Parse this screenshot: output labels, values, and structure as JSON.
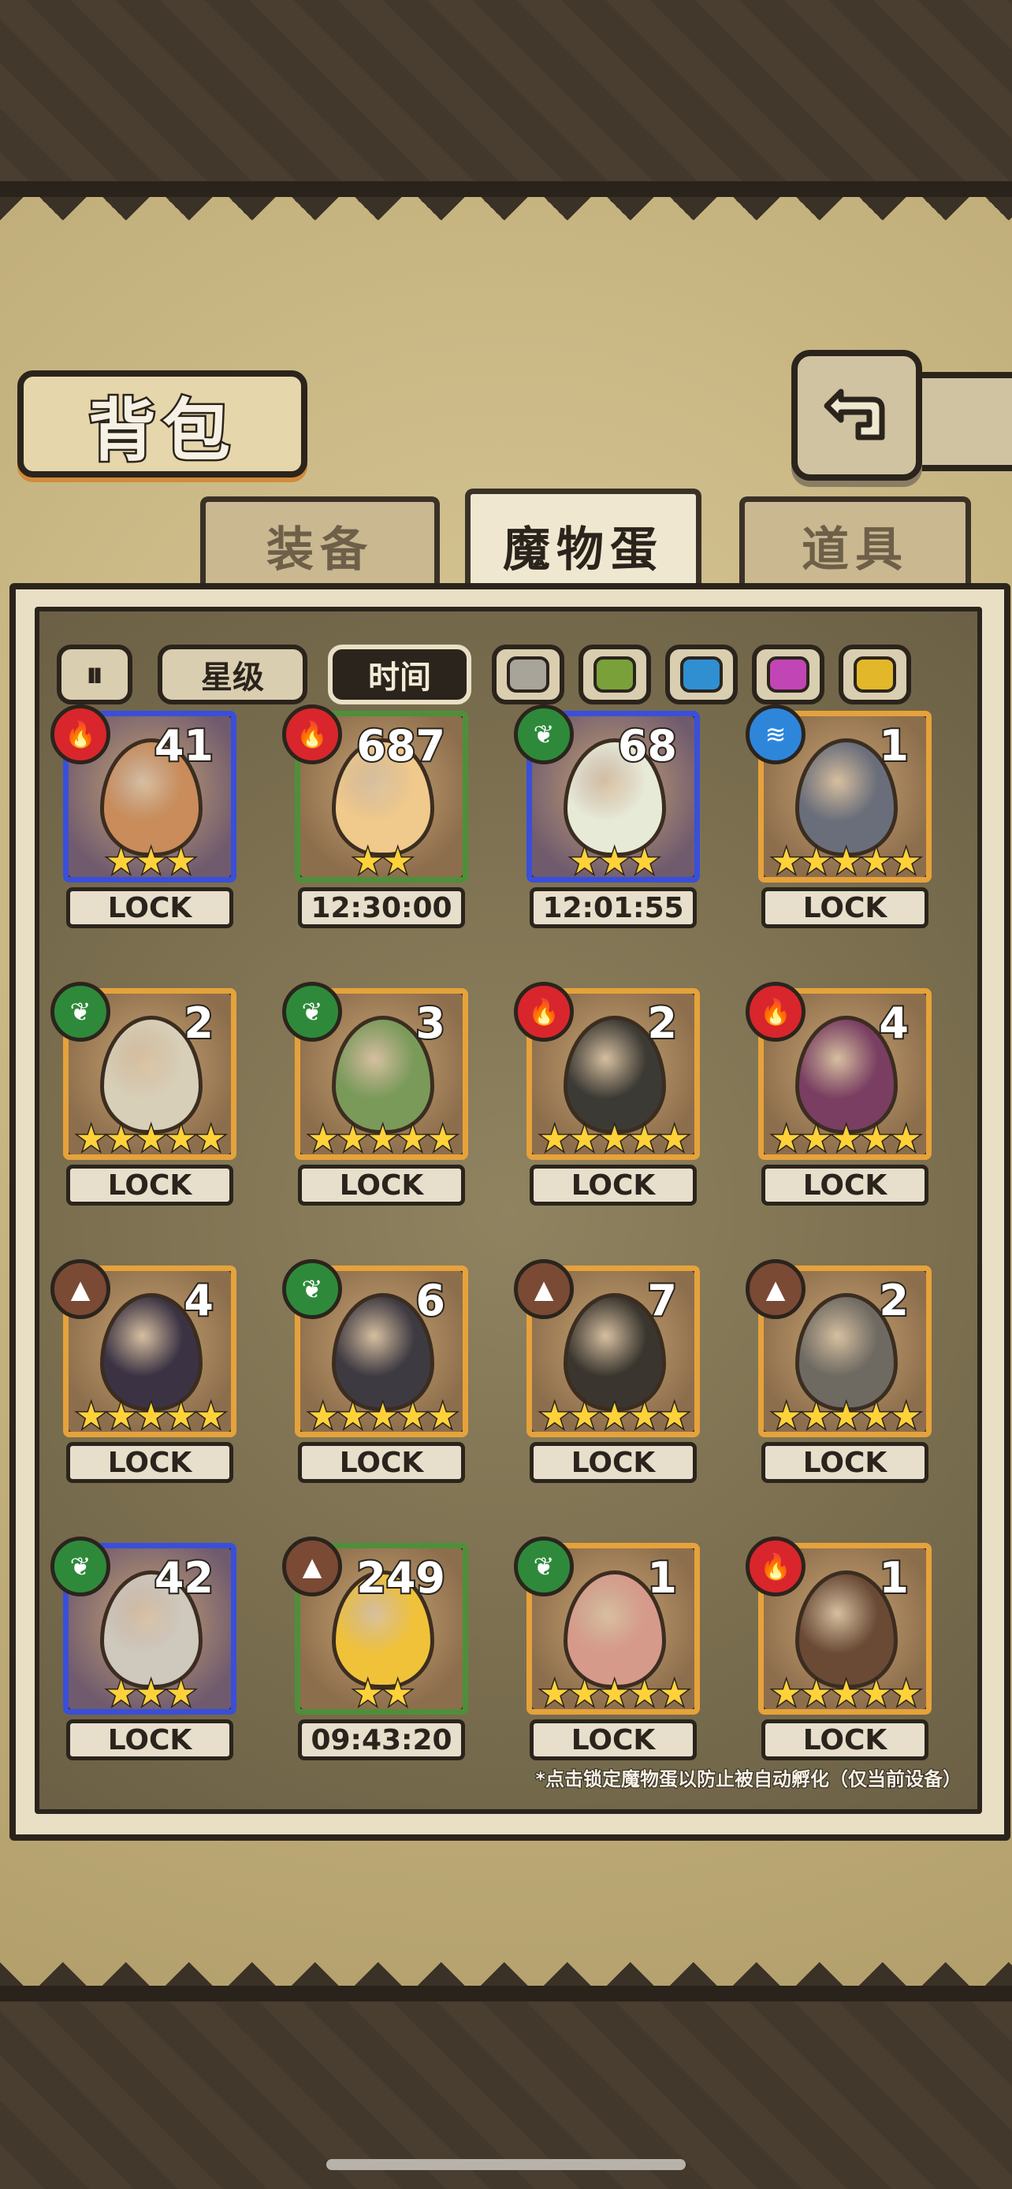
{
  "title": "背包",
  "back_icon": "back-return-icon",
  "tabs": [
    {
      "label": "装备",
      "active": false
    },
    {
      "label": "魔物蛋",
      "active": true
    },
    {
      "label": "道具",
      "active": false
    }
  ],
  "filters": {
    "toggle_icon": "sort-toggle-icon",
    "toggle_glyph": "⏸",
    "star_label": "星级",
    "time_label": "时间",
    "colors": [
      "#a9a49a",
      "#7aa03a",
      "#2f8fd1",
      "#c245b6",
      "#e3b72a"
    ]
  },
  "elements": {
    "fire": {
      "glyph": "🔥",
      "color": "#d8262c",
      "icon": "fire-element-icon"
    },
    "leaf": {
      "glyph": "❦",
      "color": "#2e8a3a",
      "icon": "leaf-element-icon"
    },
    "water": {
      "glyph": "≋",
      "color": "#2e86db",
      "icon": "water-element-icon"
    },
    "earth": {
      "glyph": "▲",
      "color": "#7a4a35",
      "icon": "earth-element-icon"
    }
  },
  "eggs": [
    {
      "count": "41",
      "element": "fire",
      "frame": "blue",
      "stars": 3,
      "label": "LOCK",
      "egg_color": "#c98c5a"
    },
    {
      "count": "687",
      "element": "fire",
      "frame": "green",
      "stars": 2,
      "label": "12:30:00",
      "egg_color": "#f0c98c"
    },
    {
      "count": "68",
      "element": "leaf",
      "frame": "blue",
      "stars": 3,
      "label": "12:01:55",
      "egg_color": "#e8ead8"
    },
    {
      "count": "1",
      "element": "water",
      "frame": "gold",
      "stars": 5,
      "label": "LOCK",
      "egg_color": "#6a6e7a"
    },
    {
      "count": "2",
      "element": "leaf",
      "frame": "gold",
      "stars": 5,
      "label": "LOCK",
      "egg_color": "#d8cfb8"
    },
    {
      "count": "3",
      "element": "leaf",
      "frame": "gold",
      "stars": 5,
      "label": "LOCK",
      "egg_color": "#7a9a5a"
    },
    {
      "count": "2",
      "element": "fire",
      "frame": "gold",
      "stars": 5,
      "label": "LOCK",
      "egg_color": "#3c3a34"
    },
    {
      "count": "4",
      "element": "fire",
      "frame": "gold",
      "stars": 5,
      "label": "LOCK",
      "egg_color": "#7a3e62"
    },
    {
      "count": "4",
      "element": "earth",
      "frame": "gold",
      "stars": 5,
      "label": "LOCK",
      "egg_color": "#3b3344"
    },
    {
      "count": "6",
      "element": "leaf",
      "frame": "gold",
      "stars": 5,
      "label": "LOCK",
      "egg_color": "#3e3a42"
    },
    {
      "count": "7",
      "element": "earth",
      "frame": "gold",
      "stars": 5,
      "label": "LOCK",
      "egg_color": "#3a362f"
    },
    {
      "count": "2",
      "element": "earth",
      "frame": "gold",
      "stars": 5,
      "label": "LOCK",
      "egg_color": "#6e6a62"
    },
    {
      "count": "42",
      "element": "leaf",
      "frame": "blue",
      "stars": 3,
      "label": "LOCK",
      "egg_color": "#cfc8bd"
    },
    {
      "count": "249",
      "element": "earth",
      "frame": "green",
      "stars": 2,
      "label": "09:43:20",
      "egg_color": "#f0c23a"
    },
    {
      "count": "1",
      "element": "leaf",
      "frame": "gold",
      "stars": 5,
      "label": "LOCK",
      "egg_color": "#d69a8a"
    },
    {
      "count": "1",
      "element": "fire",
      "frame": "gold",
      "stars": 5,
      "label": "LOCK",
      "egg_color": "#6a4a35"
    }
  ],
  "note": "*点击锁定魔物蛋以防止被自动孵化（仅当前设备）"
}
